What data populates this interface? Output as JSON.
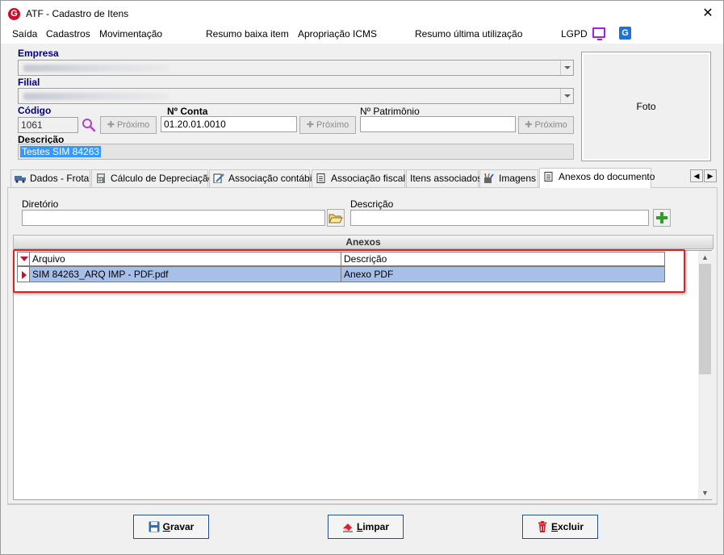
{
  "window": {
    "title": "ATF - Cadastro de Itens",
    "logo_letter": "G",
    "close_glyph": "✕"
  },
  "menu": {
    "items": [
      "Saída",
      "Cadastros",
      "Movimentação",
      "Resumo baixa item",
      "Apropriação ICMS",
      "Resumo última utilização",
      "LGPD"
    ],
    "lgpd_icon": "monitor-icon",
    "g_icon_letter": "G"
  },
  "form": {
    "empresa_label": "Empresa",
    "filial_label": "Filial",
    "codigo_label": "Código",
    "codigo_value": "1061",
    "conta_label": "Nº Conta",
    "conta_value": "01.20.01.0010",
    "patrimonio_label": "Nº Patrimônio",
    "patrimonio_value": "",
    "proximo_label": "Próximo",
    "descricao_label": "Descrição",
    "descricao_value": "Testes SIM 84263",
    "foto_label": "Foto"
  },
  "tabs": [
    {
      "label": "Dados - Frota",
      "icon": "truck-icon"
    },
    {
      "label": "Cálculo de Depreciação",
      "icon": "calculator-icon"
    },
    {
      "label": "Associação contábil",
      "icon": "edit-doc-icon"
    },
    {
      "label": "Associação fiscal",
      "icon": "document-icon"
    },
    {
      "label": "Itens associados",
      "icon": ""
    },
    {
      "label": "Imagens",
      "icon": "brush-icon"
    },
    {
      "label": "Anexos do documento",
      "icon": "document-icon"
    }
  ],
  "tab_nav": {
    "prev": "◀",
    "next": "▶"
  },
  "anexos": {
    "diretorio_label": "Diretório",
    "diretorio_value": "",
    "descricao_label": "Descrição",
    "descricao_value": "",
    "section_title": "Anexos",
    "columns": [
      "Arquivo",
      "Descrição"
    ],
    "rows": [
      {
        "arquivo": "SIM 84263_ARQ IMP - PDF.pdf",
        "descricao": "Anexo PDF"
      }
    ]
  },
  "scroll": {
    "up": "▲",
    "down": "▼"
  },
  "buttons": {
    "gravar_first": "G",
    "gravar_rest": "ravar",
    "limpar_first": "L",
    "limpar_rest": "impar",
    "excluir_first": "E",
    "excluir_rest": "xcluir"
  },
  "colors": {
    "brand": "#c8102e",
    "selection": "#3399ff",
    "row_selected": "#a8bfe8",
    "highlight": "#e02020"
  }
}
